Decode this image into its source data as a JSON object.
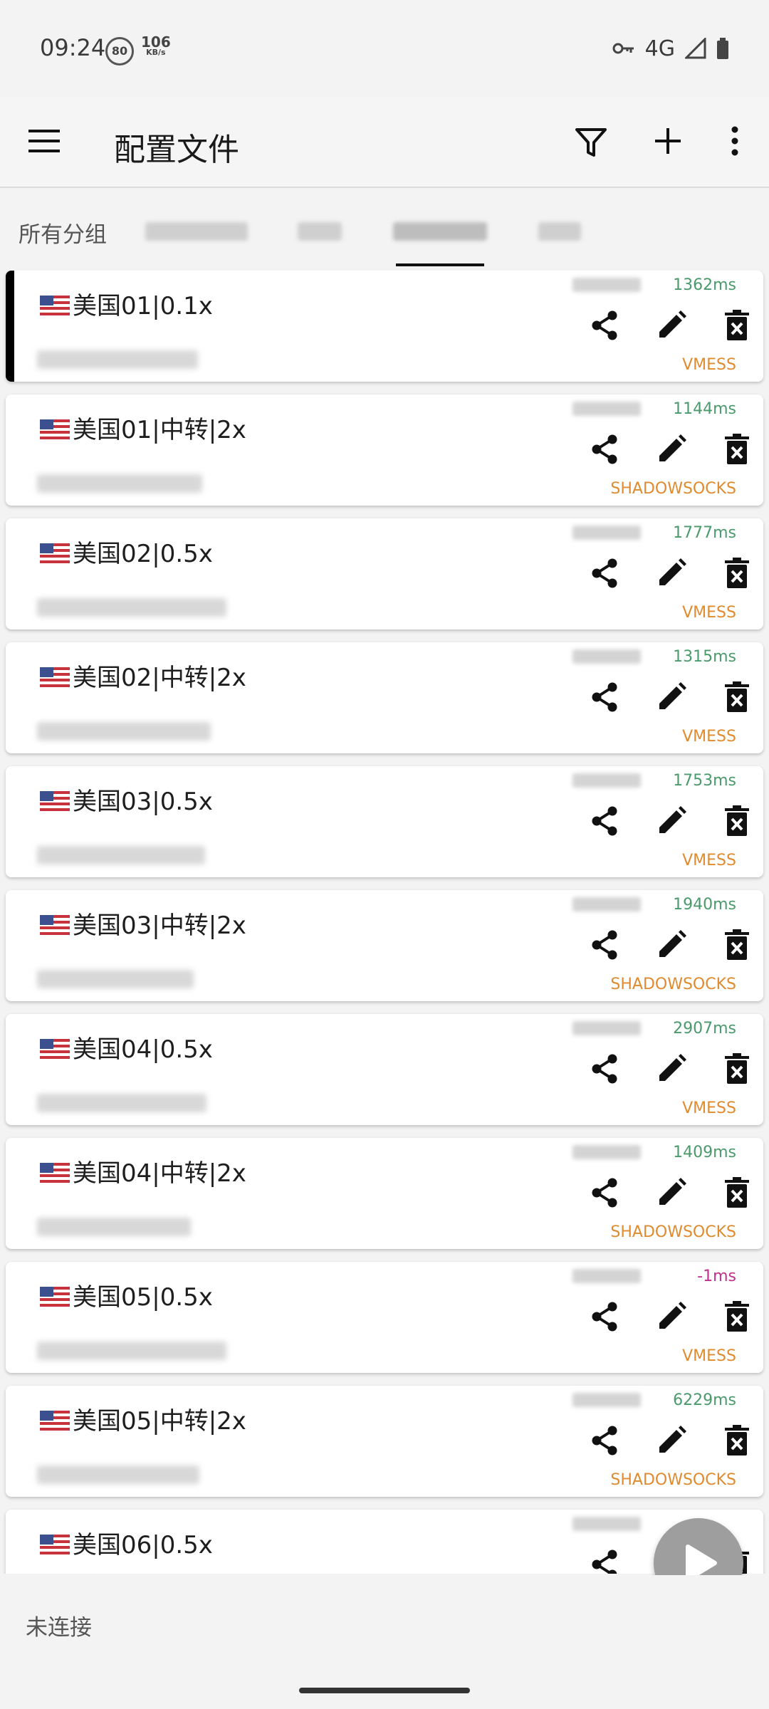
{
  "status_bar": {
    "time": "09:24",
    "circle_badge": "80",
    "speed_value": "106",
    "speed_unit": "KB/s",
    "network": "4G"
  },
  "toolbar": {
    "title": "配置文件"
  },
  "tabs": {
    "all_groups": "所有分组"
  },
  "servers": [
    {
      "name": "美国01|0.1x",
      "latency": "1362ms",
      "type": "VMESS",
      "selected": true
    },
    {
      "name": "美国01|中转|2x",
      "latency": "1144ms",
      "type": "SHADOWSOCKS"
    },
    {
      "name": "美国02|0.5x",
      "latency": "1777ms",
      "type": "VMESS"
    },
    {
      "name": "美国02|中转|2x",
      "latency": "1315ms",
      "type": "VMESS"
    },
    {
      "name": "美国03|0.5x",
      "latency": "1753ms",
      "type": "VMESS"
    },
    {
      "name": "美国03|中转|2x",
      "latency": "1940ms",
      "type": "SHADOWSOCKS"
    },
    {
      "name": "美国04|0.5x",
      "latency": "2907ms",
      "type": "VMESS"
    },
    {
      "name": "美国04|中转|2x",
      "latency": "1409ms",
      "type": "SHADOWSOCKS"
    },
    {
      "name": "美国05|0.5x",
      "latency": "-1ms",
      "type": "VMESS"
    },
    {
      "name": "美国05|中转|2x",
      "latency": "6229ms",
      "type": "SHADOWSOCKS"
    },
    {
      "name": "美国06|0.5x",
      "latency": "",
      "type": ""
    }
  ],
  "bottom": {
    "status": "未连接"
  },
  "colors": {
    "latency_ok": "#4a9a6c",
    "latency_fail": "#c0308c",
    "type": "#e08b2f",
    "fab": "#9e9e9e"
  }
}
